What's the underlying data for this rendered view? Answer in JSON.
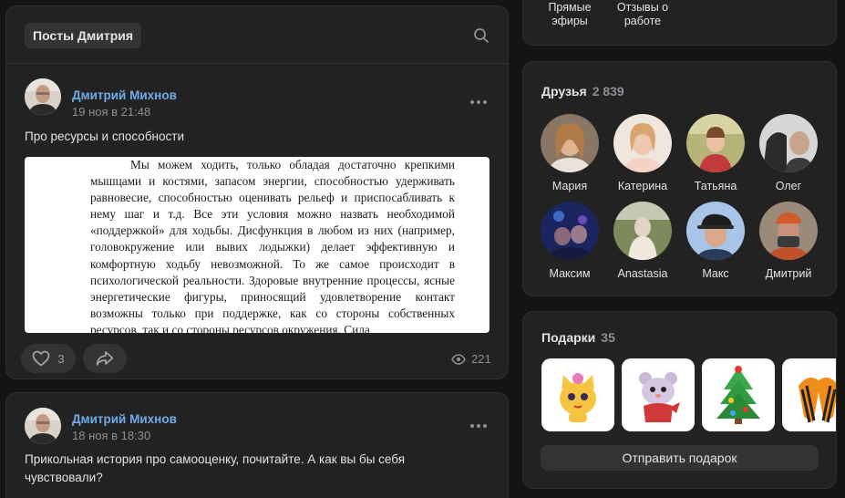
{
  "posts_section": {
    "tab_label": "Посты Дмитрия"
  },
  "post1": {
    "author": "Дмитрий Михнов",
    "date": "19 ноя в 21:48",
    "text": "Про ресурсы и способности",
    "doc_text": "Мы можем ходить, только обладая достаточно крепкими мышцами и костями, запасом энергии, способностью удерживать равновесие, способностью оценивать рельеф и приспосабливать к нему шаг и т.д. Все эти условия можно назвать необходимой «поддержкой» для ходьбы. Дисфункция в любом из них (например, головокружение или вывих лодыжки) делает эффективную и комфортную ходьбу невозможной. То же самое происходит в психологической реальности. Здоровые внутренние процессы, ясные энергетические фигуры, приносящий удовлетворение контакт возможны только при поддержке, как со стороны собственных ресурсов, так и со стороны ресурсов окружения. Сила",
    "likes": "3",
    "views": "221"
  },
  "post2": {
    "author": "Дмитрий Михнов",
    "date": "18 ноя в 18:30",
    "text": "Прикольная история про самооценку, почитайте. А как вы бы себя чувствовали?"
  },
  "top_links": {
    "live": "Прямые эфиры",
    "reviews": "Отзывы о работе"
  },
  "friends": {
    "title": "Друзья",
    "count": "2 839",
    "items": [
      {
        "name": "Мария",
        "color": "#c9a27a"
      },
      {
        "name": "Катерина",
        "color": "#e0b8a4"
      },
      {
        "name": "Татьяна",
        "color": "#9aa060"
      },
      {
        "name": "Олег",
        "color": "#6a6a6a"
      },
      {
        "name": "Максим",
        "color": "#27408a"
      },
      {
        "name": "Anastasia",
        "color": "#8a8068"
      },
      {
        "name": "Макс",
        "color": "#5d7fb0"
      },
      {
        "name": "Дмитрий",
        "color": "#b05a3a"
      }
    ]
  },
  "gifts": {
    "title": "Подарки",
    "count": "35",
    "send_label": "Отправить подарок"
  },
  "colors": {
    "link": "#71aaeb",
    "background": "#141414",
    "card": "#222222"
  }
}
